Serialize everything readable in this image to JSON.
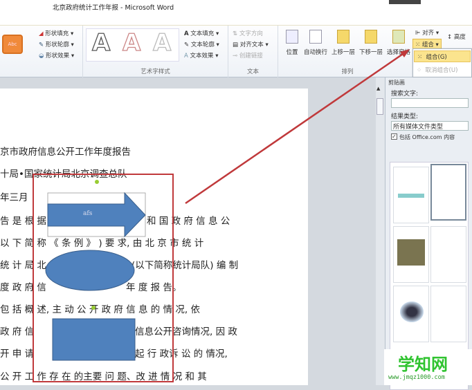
{
  "window": {
    "title": "北京政府统计工作年报 - Microsoft Word"
  },
  "ribbon": {
    "shape_styles": {
      "preview": "Abc",
      "fill": "形状填充",
      "outline": "形状轮廓",
      "effects": "形状效果"
    },
    "wordart": {
      "label": "艺术字样式",
      "sample": "A",
      "text_fill": "文本填充",
      "text_outline": "文本轮廓",
      "text_effects": "文本效果"
    },
    "text": {
      "label": "文本",
      "direction": "文字方向",
      "align": "对齐文本",
      "link": "创建链接"
    },
    "arrange": {
      "label": "排列",
      "position": "位置",
      "wrap": "自动换行",
      "forward": "上移一层",
      "backward": "下移一层",
      "selection": "选择窗格",
      "align": "对齐",
      "group": "组合",
      "height": "高度"
    }
  },
  "group_menu": {
    "items": [
      {
        "label": "组合(G)",
        "enabled": true
      },
      {
        "label": "取消组合(U)",
        "enabled": false
      }
    ]
  },
  "document": {
    "lines": [
      "京市政府信息公开工作年度报告",
      "十局•国家统计局北京调查总队",
      "年三月",
      "告 是 根 据",
      "和 国 政 府 信 息 公",
      "以 下 简 称 《 条 例 》 ) 要 求, 由 北 京 市 统 计",
      "统 计 局 北",
      "(以下简称统计局队) 编 制",
      "度 政 府 信",
      "年 度 报 告。",
      "包 括 概 述, 主 动 公 开 政 府 信 息 的 情 况, 依",
      "政 府 信",
      "信息公开咨询情况, 因 政",
      "开 申 请",
      "起 行 政诉 讼 的 情况,",
      "公 开 工 作 存 在 的主要 问 题、改 进 情 况 和 其"
    ],
    "arrow_text": "afs"
  },
  "clipart_pane": {
    "title": "剪贴画",
    "search_label": "搜索文字:",
    "search_value": "",
    "results_label": "结果类型:",
    "results_value": "所有媒体文件类型",
    "include_label": "包括 Office.com 内容",
    "include_checked": true
  },
  "watermark": {
    "site": "学知网",
    "url": "www.jmqz1000.com"
  },
  "colors": {
    "shape_fill": "#4f81bd",
    "annotation": "#c0393b"
  }
}
